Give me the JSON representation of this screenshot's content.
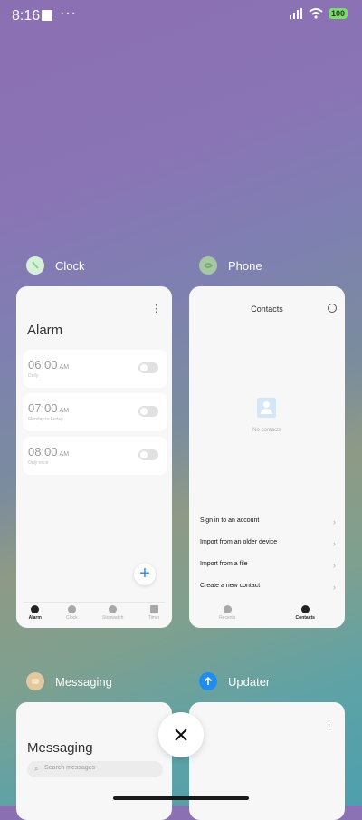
{
  "status": {
    "time": "8:16",
    "dots": "···",
    "battery": "100"
  },
  "apps": {
    "clock": {
      "name": "Clock",
      "more_menu": "⋮",
      "screen_title": "Alarm",
      "alarms": [
        {
          "time": "06:00",
          "ampm": "AM",
          "sub": "Daily"
        },
        {
          "time": "07:00",
          "ampm": "AM",
          "sub": "Monday to Friday"
        },
        {
          "time": "08:00",
          "ampm": "AM",
          "sub": "Only once"
        }
      ],
      "fab": "+",
      "tabs": [
        "Alarm",
        "Clock",
        "Stopwatch",
        "Timer"
      ],
      "active_tab": "Alarm"
    },
    "phone": {
      "name": "Phone",
      "screen_title": "Contacts",
      "empty_text": "No contacts",
      "menu": [
        "Sign in to an account",
        "Import from an older device",
        "Import from a file",
        "Create a new contact"
      ],
      "tabs": [
        "Recents",
        "Contacts"
      ],
      "active_tab": "Contacts"
    },
    "messaging": {
      "name": "Messaging",
      "screen_title": "Messaging",
      "search_placeholder": "Search messages"
    },
    "updater": {
      "name": "Updater",
      "more_menu": "⋮"
    }
  },
  "colors": {
    "accent": "#2d8cf0",
    "battery": "#7bdc6b"
  }
}
